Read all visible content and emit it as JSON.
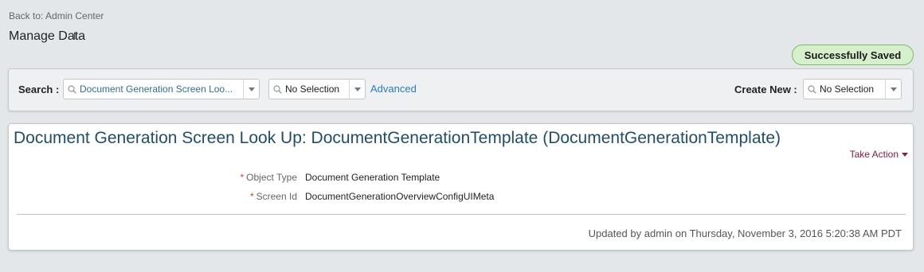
{
  "header": {
    "back_link": "Back to: Admin Center",
    "page_title": "Manage Data",
    "saved_badge": "Successfully Saved"
  },
  "search_bar": {
    "search_label": "Search :",
    "search_value": "Document Generation Screen Loo...",
    "second_select_value": "No Selection",
    "advanced_link": "Advanced",
    "create_new_label": "Create New :",
    "create_new_value": "No Selection"
  },
  "record": {
    "title": "Document Generation Screen Look Up: DocumentGenerationTemplate (DocumentGenerationTemplate)",
    "take_action": "Take Action",
    "fields": [
      {
        "required": "*",
        "label": "Object Type",
        "value": "Document Generation Template"
      },
      {
        "required": "*",
        "label": "Screen Id",
        "value": "DocumentGenerationOverviewConfigUIMeta"
      }
    ],
    "updated_text": "Updated by admin on Thursday, November 3, 2016 5:20:38 AM PDT"
  },
  "colors": {
    "background": "#e4e7ea",
    "link": "#2e7bbf",
    "title": "#1f4e6b",
    "take_action": "#8a1d3a",
    "saved_badge_bg": "#d6f0cc",
    "required_marker": "#d0432c"
  },
  "icons": [
    "magnifier-icon",
    "dropdown-arrow-icon",
    "text-cursor-icon"
  ]
}
